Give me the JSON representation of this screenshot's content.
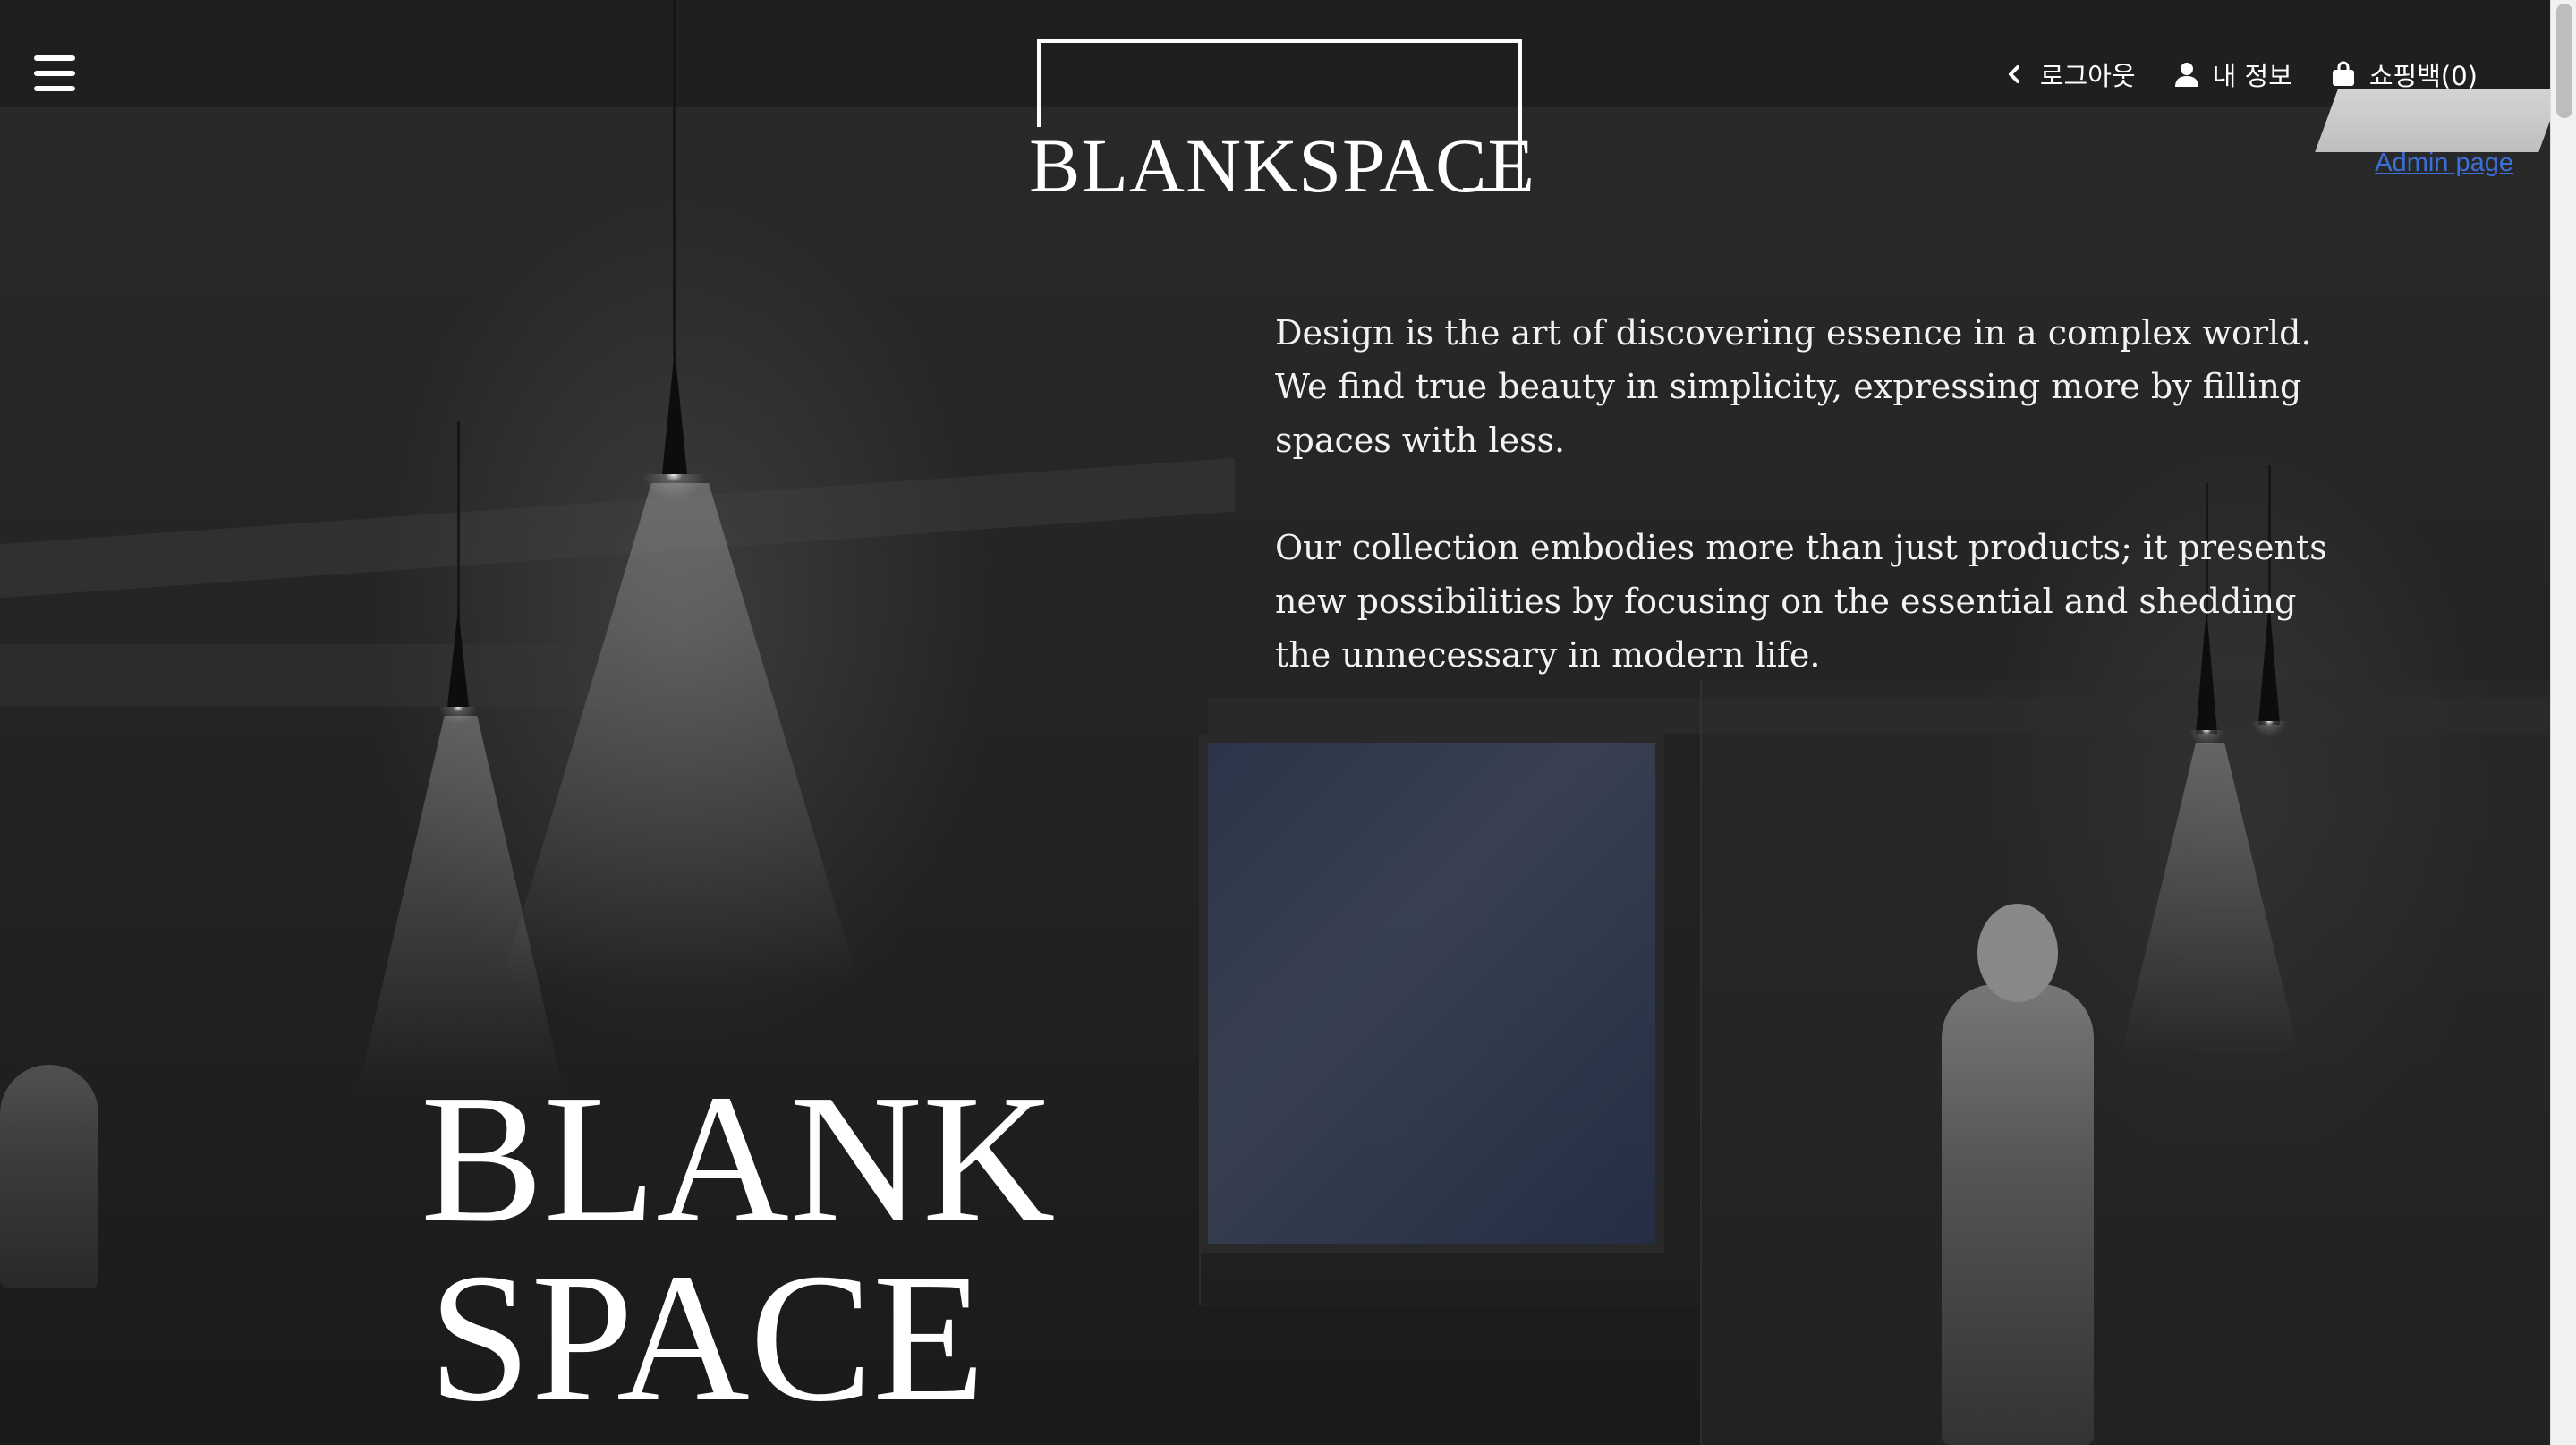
{
  "header": {
    "logo_text": "BLANKSPACE",
    "nav": {
      "logout": "로그아웃",
      "my_info": "내 정보",
      "shopping_bag": "쇼핑백(0)"
    },
    "admin_link": "Admin page"
  },
  "intro": {
    "paragraph_1": "Design is the art of discovering essence in a complex world. We find true beauty in simplicity, expressing more by filling spaces with less.",
    "paragraph_2": "Our collection embodies more than just products; it presents new possibilities by focusing on the essential and shedding the unnecessary in modern life."
  },
  "hero": {
    "line_1": "BLANK",
    "line_2": "SPACE"
  },
  "icons": {
    "menu": "hamburger-menu-icon",
    "logout": "chevron-left-icon",
    "my_info": "user-icon",
    "shopping_bag": "shopping-bag-icon"
  },
  "colors": {
    "admin_link": "#3d6fd9",
    "text": "#ffffff"
  }
}
